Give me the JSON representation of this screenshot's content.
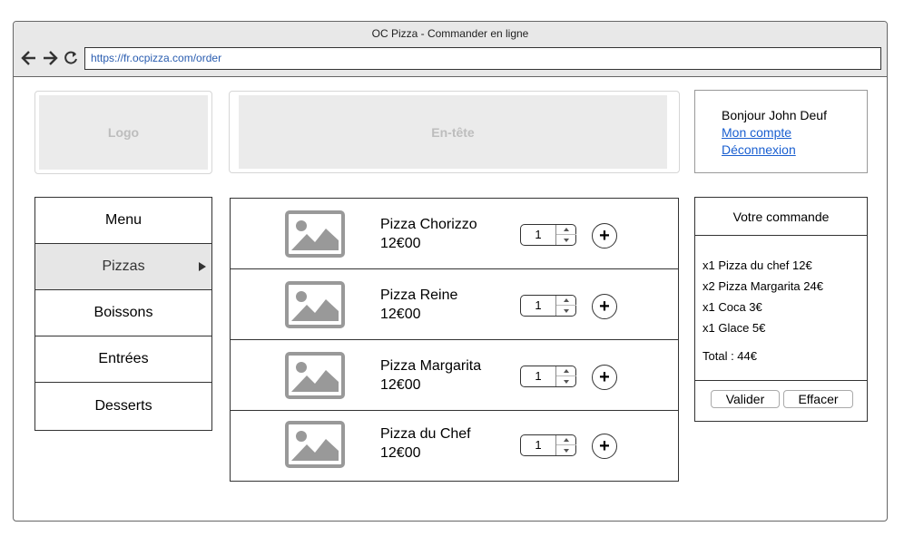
{
  "window": {
    "title": "OC Pizza - Commander en ligne",
    "url": "https://fr.ocpizza.com/order"
  },
  "icons": {
    "back": "arrow-left-icon",
    "forward": "arrow-right-icon",
    "reload": "reload-icon",
    "product_image": "image-placeholder-icon",
    "add": "plus-icon",
    "submenu": "chevron-right-icon"
  },
  "logo": {
    "label": "Logo"
  },
  "header": {
    "label": "En-tête"
  },
  "user": {
    "greeting": "Bonjour John Deuf",
    "account_link": "Mon compte",
    "logout_link": "Déconnexion"
  },
  "menu": {
    "items": [
      {
        "label": "Menu"
      },
      {
        "label": "Pizzas"
      },
      {
        "label": "Boissons"
      },
      {
        "label": "Entrées"
      },
      {
        "label": "Desserts"
      }
    ]
  },
  "products": [
    {
      "name": "Pizza Chorizzo",
      "price": "12€00",
      "quantity": "1",
      "add_label": "+"
    },
    {
      "name": "Pizza Reine",
      "price": "12€00",
      "quantity": "1",
      "add_label": "+"
    },
    {
      "name": "Pizza Margarita",
      "price": "12€00",
      "quantity": "1",
      "add_label": "+"
    },
    {
      "name": "Pizza du Chef",
      "price": "12€00",
      "quantity": "1",
      "add_label": "+"
    }
  ],
  "order": {
    "title": "Votre commande",
    "lines": [
      "x1 Pizza du chef 12€",
      "x2 Pizza Margarita 24€",
      "x1 Coca 3€",
      "x1 Glace 5€"
    ],
    "total": "Total : 44€",
    "validate_label": "Valider",
    "clear_label": "Effacer"
  },
  "colors": {
    "link": "#1a5fd0",
    "url_text": "#2a5db0",
    "placeholder_fill": "#ebebeb",
    "placeholder_text": "#bdbdbd",
    "active_menu_bg": "#e6e6e6",
    "icon_gray": "#999999"
  }
}
